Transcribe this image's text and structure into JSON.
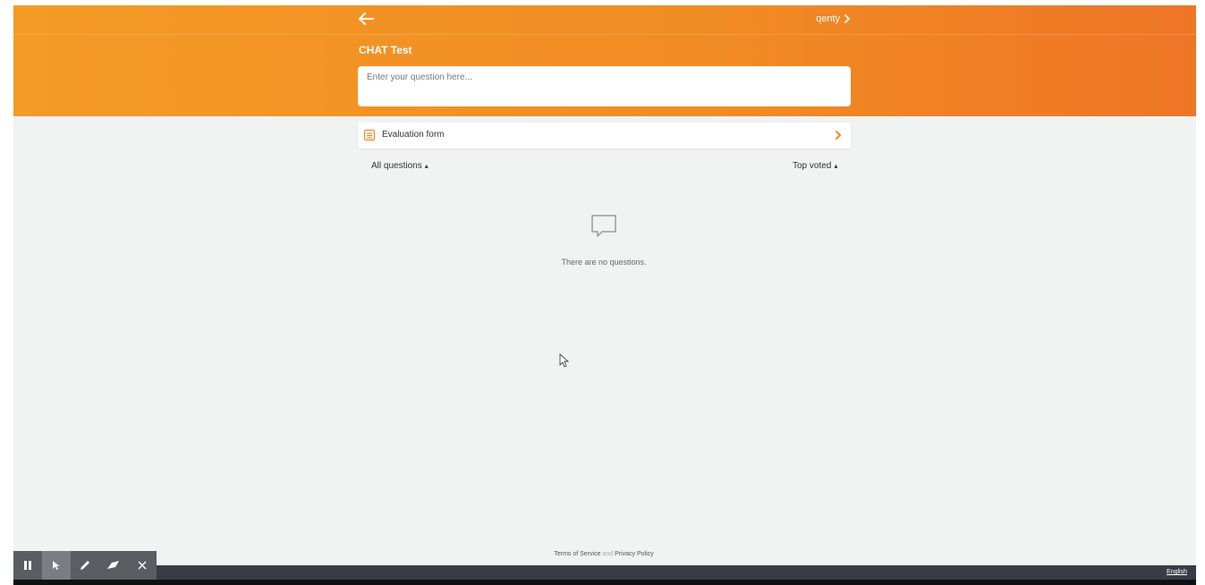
{
  "header": {
    "back_icon": "arrow-left-icon",
    "user_name": "qenty",
    "title": "CHAT Test",
    "question_placeholder": "Enter your question here..."
  },
  "evaluation": {
    "icon": "form-list-icon",
    "label": "Evaluation form"
  },
  "filters": {
    "left_label": "All questions",
    "right_label": "Top voted"
  },
  "empty_state": {
    "icon": "chat-bubble-icon",
    "text": "There are no questions."
  },
  "footer": {
    "terms": "Terms of Service",
    "and": "and",
    "privacy": "Privacy Policy",
    "language": "English"
  },
  "toolbar": {
    "tools": [
      "pause-icon",
      "pointer-icon",
      "pen-icon",
      "eraser-icon",
      "close-icon"
    ]
  },
  "colors": {
    "accent": "#f18b23",
    "background": "#f1f2f2",
    "bottom_bar": "#373c46"
  }
}
